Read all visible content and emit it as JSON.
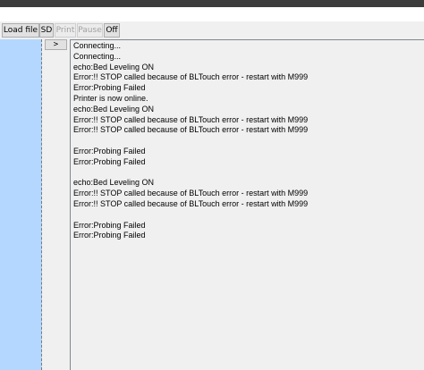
{
  "toolbar": {
    "load_file": "Load file",
    "sd": "SD",
    "print": "Print",
    "pause": "Pause",
    "off": "Off"
  },
  "send_button": ">",
  "log_lines": [
    "Connecting...",
    "Connecting...",
    "echo:Bed Leveling ON",
    "Error:!! STOP called because of BLTouch error - restart with M999",
    "Error:Probing Failed",
    "Printer is now online.",
    "echo:Bed Leveling ON",
    "Error:!! STOP called because of BLTouch error - restart with M999",
    "Error:!! STOP called because of BLTouch error - restart with M999",
    "",
    "Error:Probing Failed",
    "Error:Probing Failed",
    "",
    "echo:Bed Leveling ON",
    "Error:!! STOP called because of BLTouch error - restart with M999",
    "Error:!! STOP called because of BLTouch error - restart with M999",
    "",
    "Error:Probing Failed",
    "Error:Probing Failed"
  ],
  "colors": {
    "titlebar": "#3c3c3c",
    "selection": "#b3d7ff",
    "panel": "#f0f0f0"
  }
}
